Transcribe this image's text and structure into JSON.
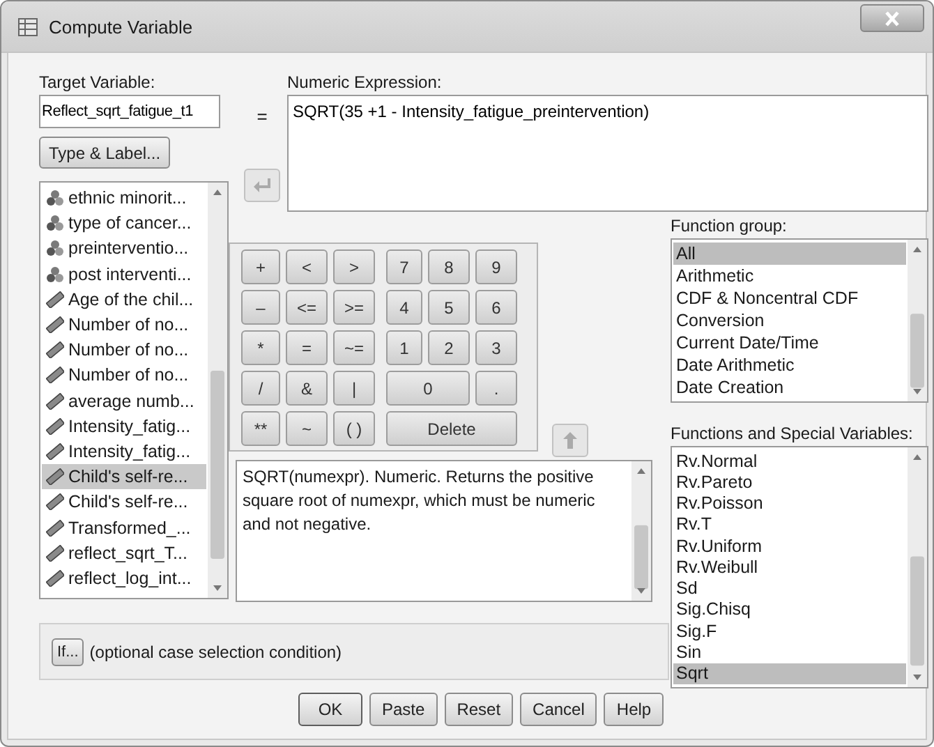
{
  "window": {
    "title": "Compute Variable"
  },
  "target": {
    "label": "Target Variable:",
    "value": "Reflect_sqrt_fatigue_t1"
  },
  "equals": "=",
  "type_label_button": "Type & Label...",
  "variables": [
    {
      "kind": "nominal",
      "label": "ethnic minorit...",
      "selected": false
    },
    {
      "kind": "nominal",
      "label": "type of cancer...",
      "selected": false
    },
    {
      "kind": "nominal",
      "label": "preinterventio...",
      "selected": false
    },
    {
      "kind": "nominal",
      "label": "post interventi...",
      "selected": false
    },
    {
      "kind": "scale",
      "label": "Age of the chil...",
      "selected": false
    },
    {
      "kind": "scale",
      "label": "Number of no...",
      "selected": false
    },
    {
      "kind": "scale",
      "label": "Number of no...",
      "selected": false
    },
    {
      "kind": "scale",
      "label": "Number of no...",
      "selected": false
    },
    {
      "kind": "scale",
      "label": "average numb...",
      "selected": false
    },
    {
      "kind": "scale",
      "label": "Intensity_fatig...",
      "selected": false
    },
    {
      "kind": "scale",
      "label": "Intensity_fatig...",
      "selected": false
    },
    {
      "kind": "scale",
      "label": "Child's self-re...",
      "selected": true
    },
    {
      "kind": "scale",
      "label": "Child's self-re...",
      "selected": false
    },
    {
      "kind": "scale",
      "label": "Transformed_...",
      "selected": false
    },
    {
      "kind": "scale",
      "label": "reflect_sqrt_T...",
      "selected": false
    },
    {
      "kind": "scale",
      "label": "reflect_log_int...",
      "selected": false
    }
  ],
  "expression": {
    "label": "Numeric Expression:",
    "value": "SQRT(35 +1 - Intensity_fatigue_preintervention)"
  },
  "keypad": [
    [
      {
        "text": "+",
        "kind": "single"
      },
      {
        "text": "<",
        "kind": "single"
      },
      {
        "text": ">",
        "kind": "single"
      },
      {
        "text": "7",
        "kind": "single"
      },
      {
        "text": "8",
        "kind": "single"
      },
      {
        "text": "9",
        "kind": "single"
      }
    ],
    [
      {
        "text": "–",
        "kind": "single"
      },
      {
        "text": "<=",
        "kind": "single"
      },
      {
        "text": ">=",
        "kind": "single"
      },
      {
        "text": "4",
        "kind": "single"
      },
      {
        "text": "5",
        "kind": "single"
      },
      {
        "text": "6",
        "kind": "single"
      }
    ],
    [
      {
        "text": "*",
        "kind": "single"
      },
      {
        "text": "=",
        "kind": "single"
      },
      {
        "text": "~=",
        "kind": "single"
      },
      {
        "text": "1",
        "kind": "single"
      },
      {
        "text": "2",
        "kind": "single"
      },
      {
        "text": "3",
        "kind": "single"
      }
    ],
    [
      {
        "text": "/",
        "kind": "single"
      },
      {
        "text": "&",
        "kind": "single"
      },
      {
        "text": "|",
        "kind": "single"
      },
      {
        "text": "0",
        "kind": "double"
      },
      {
        "text": ".",
        "kind": "single"
      }
    ],
    [
      {
        "text": "**",
        "kind": "single"
      },
      {
        "text": "~",
        "kind": "single"
      },
      {
        "text": "( )",
        "kind": "single"
      },
      {
        "text": "Delete",
        "kind": "triple"
      }
    ]
  ],
  "description": "SQRT(numexpr). Numeric. Returns the positive square root of numexpr, which must be numeric and not negative.",
  "function_group": {
    "label": "Function group:",
    "items": [
      {
        "label": "All",
        "selected": true
      },
      {
        "label": "Arithmetic",
        "selected": false
      },
      {
        "label": "CDF & Noncentral CDF",
        "selected": false
      },
      {
        "label": "Conversion",
        "selected": false
      },
      {
        "label": "Current Date/Time",
        "selected": false
      },
      {
        "label": "Date Arithmetic",
        "selected": false
      },
      {
        "label": "Date Creation",
        "selected": false
      }
    ]
  },
  "functions": {
    "label": "Functions and Special Variables:",
    "items": [
      {
        "label": "Rv.Normal",
        "selected": false
      },
      {
        "label": "Rv.Pareto",
        "selected": false
      },
      {
        "label": "Rv.Poisson",
        "selected": false
      },
      {
        "label": "Rv.T",
        "selected": false
      },
      {
        "label": "Rv.Uniform",
        "selected": false
      },
      {
        "label": "Rv.Weibull",
        "selected": false
      },
      {
        "label": "Sd",
        "selected": false
      },
      {
        "label": "Sig.Chisq",
        "selected": false
      },
      {
        "label": "Sig.F",
        "selected": false
      },
      {
        "label": "Sin",
        "selected": false
      },
      {
        "label": "Sqrt",
        "selected": true
      }
    ]
  },
  "if_condition": {
    "button": "If...",
    "text": "(optional case selection condition)"
  },
  "buttons": [
    "OK",
    "Paste",
    "Reset",
    "Cancel",
    "Help"
  ]
}
